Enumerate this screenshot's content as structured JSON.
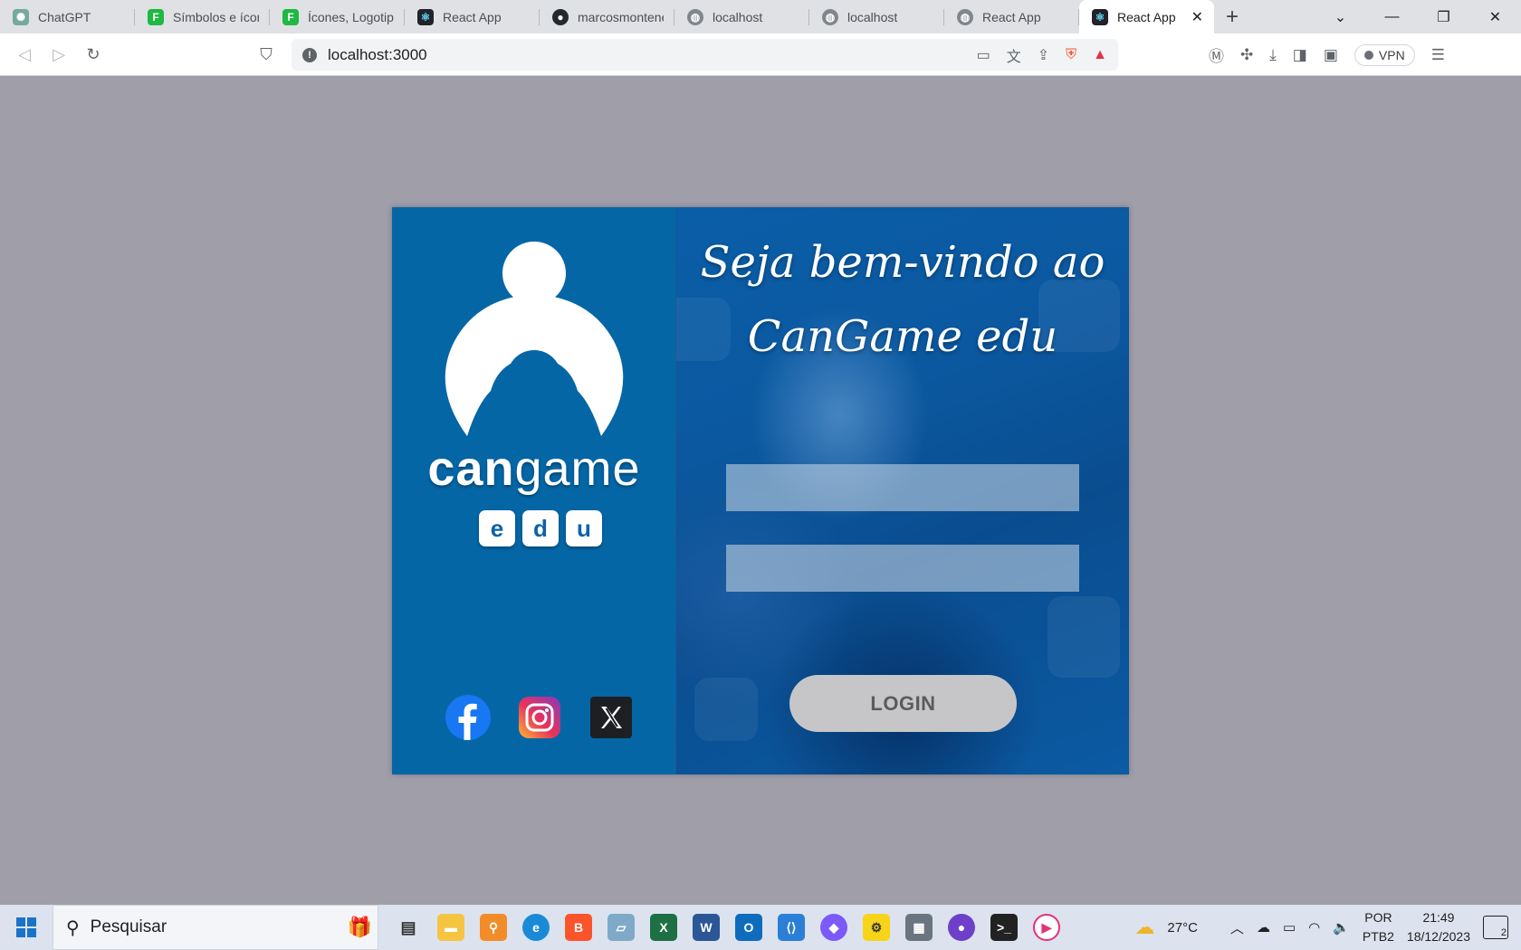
{
  "browser": {
    "tabs": [
      {
        "label": "ChatGPT",
        "icon": "chatgpt-icon",
        "color": "#74aa9c"
      },
      {
        "label": "Símbolos e ícones",
        "icon": "flaticon-icon",
        "color": "#1fb841"
      },
      {
        "label": "Ícones, Logotipos",
        "icon": "flaticon-icon",
        "color": "#1fb841"
      },
      {
        "label": "React App",
        "icon": "react-icon",
        "color": "#20232a"
      },
      {
        "label": "marcosmontenegro",
        "icon": "github-icon",
        "color": "#24292e"
      },
      {
        "label": "localhost",
        "icon": "globe-icon",
        "color": "#80868b"
      },
      {
        "label": "localhost",
        "icon": "globe-icon",
        "color": "#80868b"
      },
      {
        "label": "React App",
        "icon": "globe-icon",
        "color": "#80868b"
      },
      {
        "label": "React App",
        "icon": "react-icon",
        "color": "#20232a",
        "active": true
      }
    ],
    "url": "localhost:3000",
    "vpn_label": "VPN"
  },
  "page": {
    "welcome_line1": "Seja bem-vindo ao",
    "welcome_line2": "CanGame edu",
    "brand_can": "can",
    "brand_game": "game",
    "edu_letters": [
      "e",
      "d",
      "u"
    ],
    "username_placeholder": "",
    "password_placeholder": "",
    "login_label": "LOGIN",
    "social": [
      "facebook-icon",
      "instagram-icon",
      "x-icon"
    ],
    "colors": {
      "left_panel": "#0566a6",
      "button": "#c6c6c8",
      "page_bg": "#9f9ea9"
    }
  },
  "taskbar": {
    "search_placeholder": "Pesquisar",
    "weather": "27°C",
    "lang_top": "POR",
    "lang_bottom": "PTB2",
    "time": "21:49",
    "date": "18/12/2023",
    "notifications": "2"
  }
}
